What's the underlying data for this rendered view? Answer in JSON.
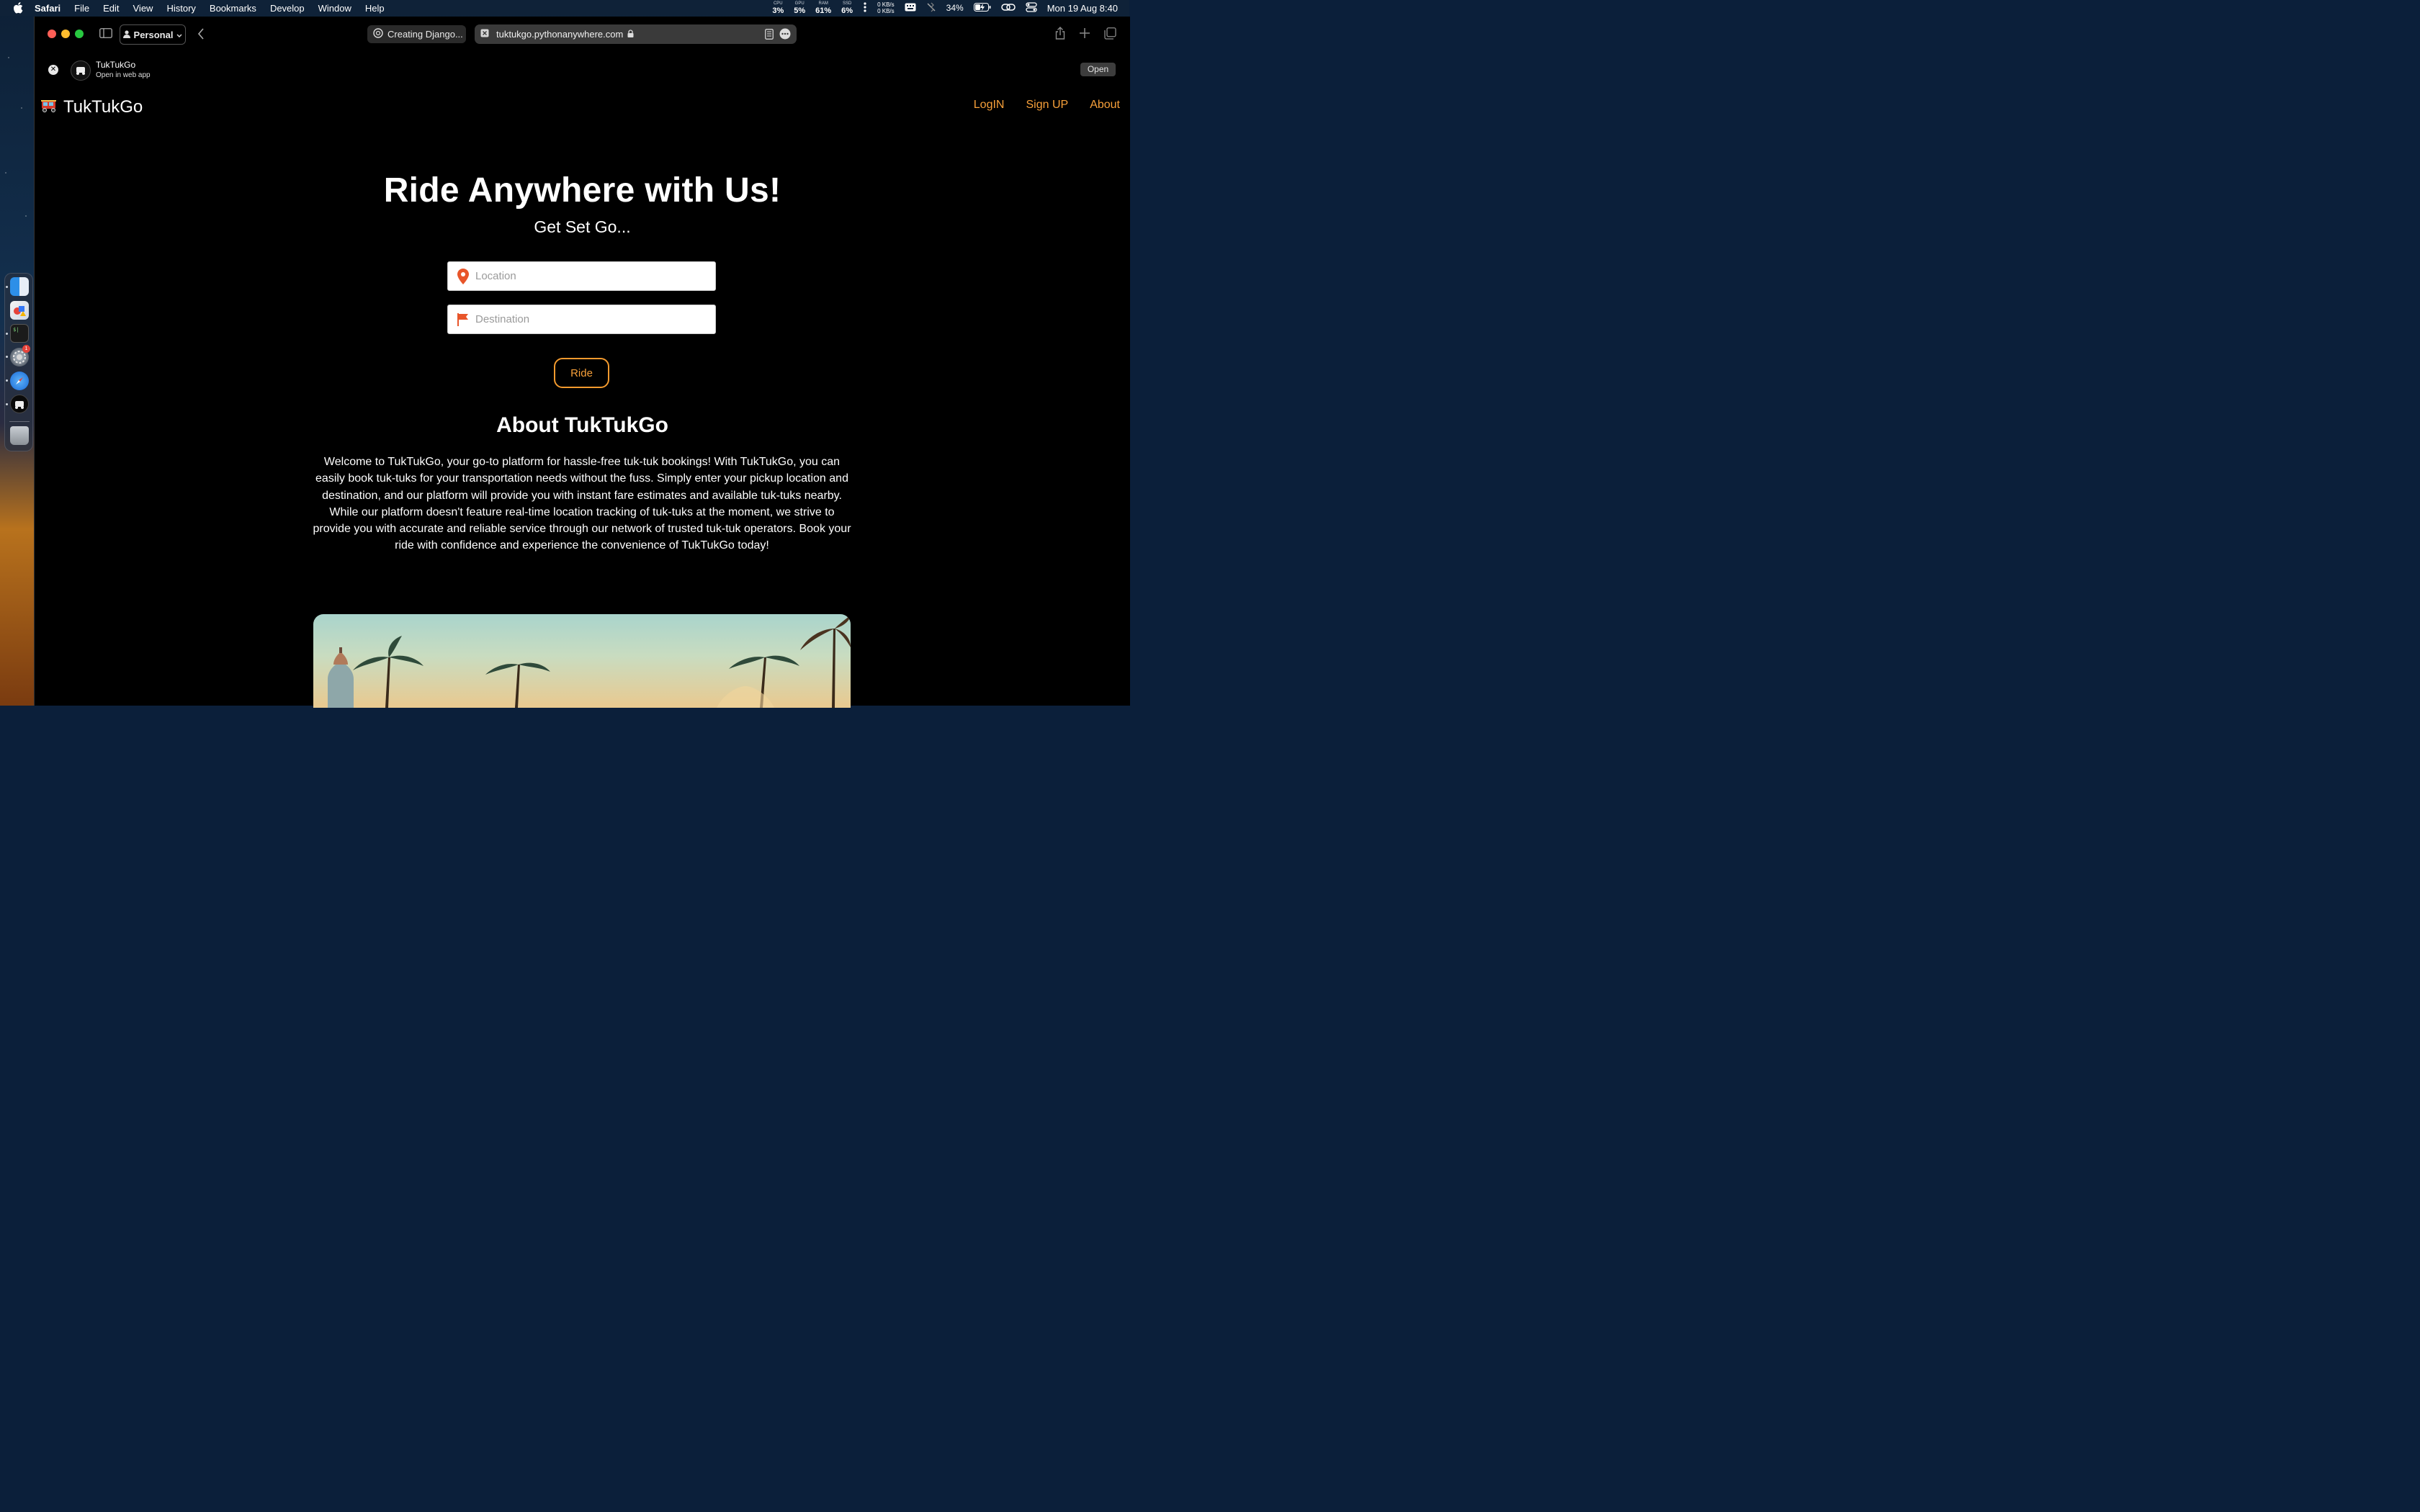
{
  "menubar": {
    "app": "Safari",
    "items": [
      "File",
      "Edit",
      "View",
      "History",
      "Bookmarks",
      "Develop",
      "Window",
      "Help"
    ],
    "stats": [
      {
        "key": "CPU",
        "value": "3%"
      },
      {
        "key": "GPU",
        "value": "5%"
      },
      {
        "key": "RAM",
        "value": "61%"
      },
      {
        "key": "SSD",
        "value": "6%"
      }
    ],
    "net_up": "0 KB/s",
    "net_down": "0 KB/s",
    "battery": "34%",
    "clock": "Mon 19 Aug  8:40"
  },
  "browser": {
    "profile": "Personal",
    "tab_title": "Creating Django...",
    "url": "tuktukgo.pythonanywhere.com"
  },
  "webapp_banner": {
    "name": "TukTukGo",
    "subtitle": "Open in web app",
    "open_label": "Open"
  },
  "site": {
    "brand": "TukTukGo",
    "nav": {
      "login": "LogIN",
      "signup": "Sign UP",
      "about": "About"
    },
    "hero_title": "Ride Anywhere with Us!",
    "hero_subtitle": "Get Set Go...",
    "location_placeholder": "Location",
    "destination_placeholder": "Destination",
    "ride_label": "Ride",
    "about_title": "About TukTukGo",
    "about_text": "Welcome to TukTukGo, your go-to platform for hassle-free tuk-tuk bookings! With TukTukGo, you can easily book tuk-tuks for your transportation needs without the fuss. Simply enter your pickup location and destination, and our platform will provide you with instant fare estimates and available tuk-tuks nearby. While our platform doesn't feature real-time location tracking of tuk-tuks at the moment, we strive to provide you with accurate and reliable service through our network of trusted tuk-tuk operators. Book your ride with confidence and experience the convenience of TukTukGo today!"
  },
  "colors": {
    "accent": "#f7a03a",
    "background": "#000000",
    "pin": "#e8552a"
  },
  "dock": {
    "badge_count": "1"
  }
}
